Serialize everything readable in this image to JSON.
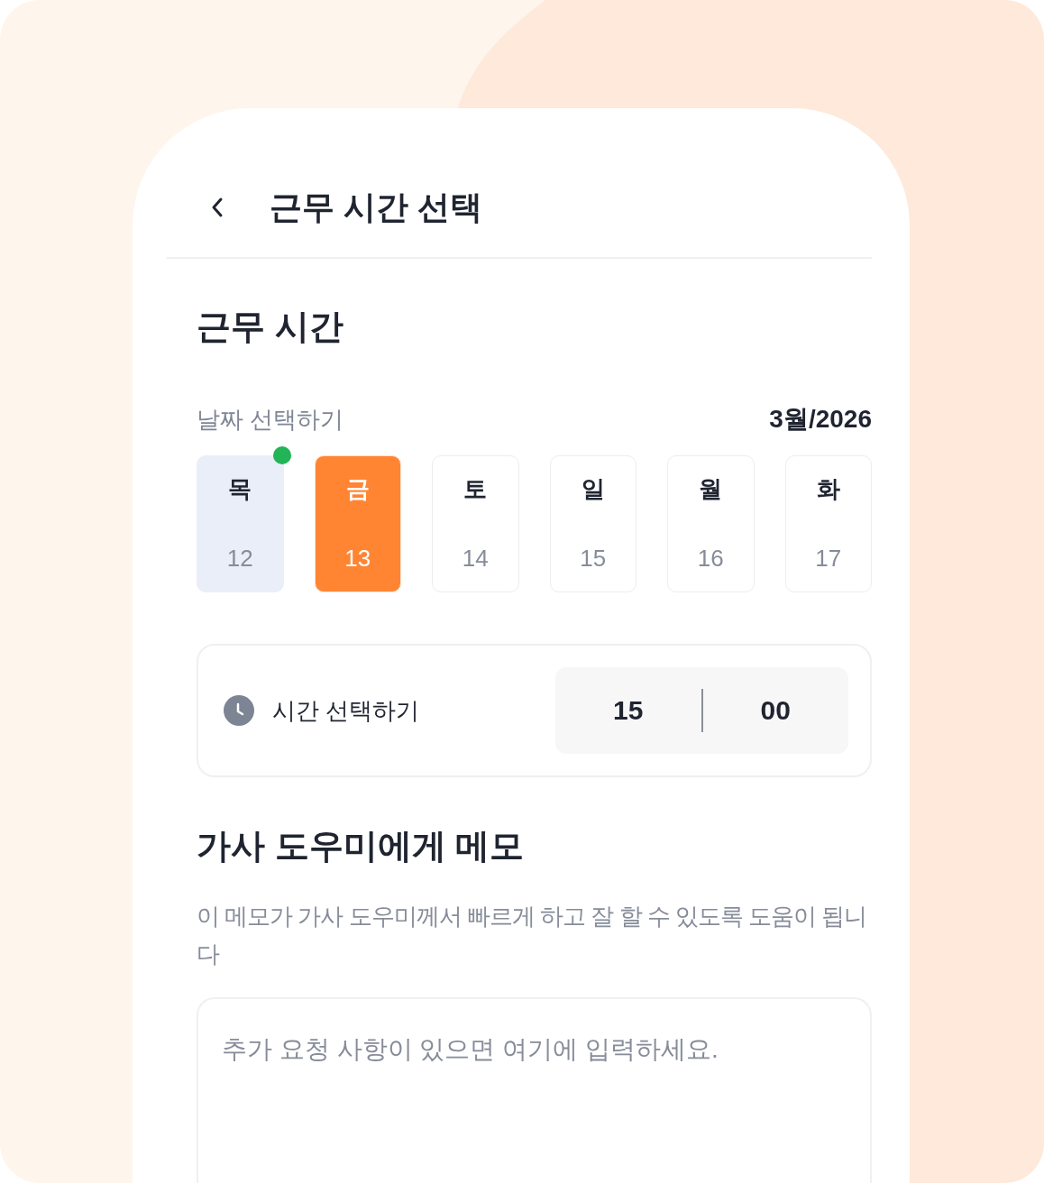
{
  "header": {
    "title": "근무 시간 선택"
  },
  "work_time": {
    "title": "근무 시간",
    "date_label": "날짜 선택하기",
    "month": "3월/2026",
    "days": [
      {
        "weekday": "목",
        "date": "12",
        "selected": false,
        "today": true
      },
      {
        "weekday": "금",
        "date": "13",
        "selected": true,
        "today": false
      },
      {
        "weekday": "토",
        "date": "14",
        "selected": false,
        "today": false
      },
      {
        "weekday": "일",
        "date": "15",
        "selected": false,
        "today": false
      },
      {
        "weekday": "월",
        "date": "16",
        "selected": false,
        "today": false
      },
      {
        "weekday": "화",
        "date": "17",
        "selected": false,
        "today": false
      }
    ]
  },
  "time_picker": {
    "label": "시간 선택하기",
    "hour": "15",
    "minute": "00"
  },
  "memo": {
    "title": "가사 도우미에게 메모",
    "description": "이 메모가 가사 도우미께서 빠르게 하고 잘 할 수 있도록 도움이 됩니다",
    "placeholder": "추가 요청 사항이 있으면 여기에 입력하세요."
  }
}
